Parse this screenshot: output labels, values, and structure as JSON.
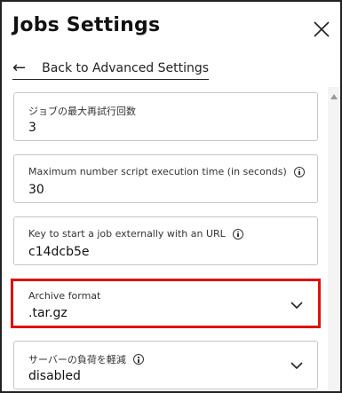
{
  "header": {
    "title": "Jobs Settings",
    "back_label": "Back to Advanced Settings"
  },
  "fields": [
    {
      "label": "ジョブの最大再試行回数",
      "value": "3",
      "info": false
    },
    {
      "label": "Maximum number script execution time (in seconds)",
      "value": "30",
      "info": true
    },
    {
      "label": "Key to start a job externally with an URL",
      "value": "c14dcb5e",
      "info": true
    },
    {
      "label": "Archive format",
      "value": ".tar.gz",
      "info": false,
      "type": "select",
      "highlighted": true,
      "highlight_color": "#e01010"
    },
    {
      "label": "サーバーの負荷を軽減",
      "value": "disabled",
      "info": true,
      "type": "select"
    }
  ],
  "icons": {
    "close": "close-icon",
    "back": "arrow-left-icon",
    "info": "info-icon",
    "dropdown": "chevron-down-icon"
  }
}
